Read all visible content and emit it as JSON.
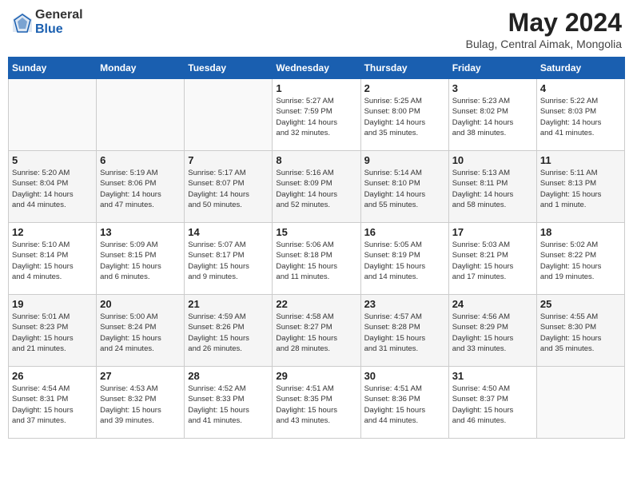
{
  "header": {
    "logo_general": "General",
    "logo_blue": "Blue",
    "month_title": "May 2024",
    "location": "Bulag, Central Aimak, Mongolia"
  },
  "weekdays": [
    "Sunday",
    "Monday",
    "Tuesday",
    "Wednesday",
    "Thursday",
    "Friday",
    "Saturday"
  ],
  "weeks": [
    [
      {
        "day": "",
        "info": ""
      },
      {
        "day": "",
        "info": ""
      },
      {
        "day": "",
        "info": ""
      },
      {
        "day": "1",
        "info": "Sunrise: 5:27 AM\nSunset: 7:59 PM\nDaylight: 14 hours\nand 32 minutes."
      },
      {
        "day": "2",
        "info": "Sunrise: 5:25 AM\nSunset: 8:00 PM\nDaylight: 14 hours\nand 35 minutes."
      },
      {
        "day": "3",
        "info": "Sunrise: 5:23 AM\nSunset: 8:02 PM\nDaylight: 14 hours\nand 38 minutes."
      },
      {
        "day": "4",
        "info": "Sunrise: 5:22 AM\nSunset: 8:03 PM\nDaylight: 14 hours\nand 41 minutes."
      }
    ],
    [
      {
        "day": "5",
        "info": "Sunrise: 5:20 AM\nSunset: 8:04 PM\nDaylight: 14 hours\nand 44 minutes."
      },
      {
        "day": "6",
        "info": "Sunrise: 5:19 AM\nSunset: 8:06 PM\nDaylight: 14 hours\nand 47 minutes."
      },
      {
        "day": "7",
        "info": "Sunrise: 5:17 AM\nSunset: 8:07 PM\nDaylight: 14 hours\nand 50 minutes."
      },
      {
        "day": "8",
        "info": "Sunrise: 5:16 AM\nSunset: 8:09 PM\nDaylight: 14 hours\nand 52 minutes."
      },
      {
        "day": "9",
        "info": "Sunrise: 5:14 AM\nSunset: 8:10 PM\nDaylight: 14 hours\nand 55 minutes."
      },
      {
        "day": "10",
        "info": "Sunrise: 5:13 AM\nSunset: 8:11 PM\nDaylight: 14 hours\nand 58 minutes."
      },
      {
        "day": "11",
        "info": "Sunrise: 5:11 AM\nSunset: 8:13 PM\nDaylight: 15 hours\nand 1 minute."
      }
    ],
    [
      {
        "day": "12",
        "info": "Sunrise: 5:10 AM\nSunset: 8:14 PM\nDaylight: 15 hours\nand 4 minutes."
      },
      {
        "day": "13",
        "info": "Sunrise: 5:09 AM\nSunset: 8:15 PM\nDaylight: 15 hours\nand 6 minutes."
      },
      {
        "day": "14",
        "info": "Sunrise: 5:07 AM\nSunset: 8:17 PM\nDaylight: 15 hours\nand 9 minutes."
      },
      {
        "day": "15",
        "info": "Sunrise: 5:06 AM\nSunset: 8:18 PM\nDaylight: 15 hours\nand 11 minutes."
      },
      {
        "day": "16",
        "info": "Sunrise: 5:05 AM\nSunset: 8:19 PM\nDaylight: 15 hours\nand 14 minutes."
      },
      {
        "day": "17",
        "info": "Sunrise: 5:03 AM\nSunset: 8:21 PM\nDaylight: 15 hours\nand 17 minutes."
      },
      {
        "day": "18",
        "info": "Sunrise: 5:02 AM\nSunset: 8:22 PM\nDaylight: 15 hours\nand 19 minutes."
      }
    ],
    [
      {
        "day": "19",
        "info": "Sunrise: 5:01 AM\nSunset: 8:23 PM\nDaylight: 15 hours\nand 21 minutes."
      },
      {
        "day": "20",
        "info": "Sunrise: 5:00 AM\nSunset: 8:24 PM\nDaylight: 15 hours\nand 24 minutes."
      },
      {
        "day": "21",
        "info": "Sunrise: 4:59 AM\nSunset: 8:26 PM\nDaylight: 15 hours\nand 26 minutes."
      },
      {
        "day": "22",
        "info": "Sunrise: 4:58 AM\nSunset: 8:27 PM\nDaylight: 15 hours\nand 28 minutes."
      },
      {
        "day": "23",
        "info": "Sunrise: 4:57 AM\nSunset: 8:28 PM\nDaylight: 15 hours\nand 31 minutes."
      },
      {
        "day": "24",
        "info": "Sunrise: 4:56 AM\nSunset: 8:29 PM\nDaylight: 15 hours\nand 33 minutes."
      },
      {
        "day": "25",
        "info": "Sunrise: 4:55 AM\nSunset: 8:30 PM\nDaylight: 15 hours\nand 35 minutes."
      }
    ],
    [
      {
        "day": "26",
        "info": "Sunrise: 4:54 AM\nSunset: 8:31 PM\nDaylight: 15 hours\nand 37 minutes."
      },
      {
        "day": "27",
        "info": "Sunrise: 4:53 AM\nSunset: 8:32 PM\nDaylight: 15 hours\nand 39 minutes."
      },
      {
        "day": "28",
        "info": "Sunrise: 4:52 AM\nSunset: 8:33 PM\nDaylight: 15 hours\nand 41 minutes."
      },
      {
        "day": "29",
        "info": "Sunrise: 4:51 AM\nSunset: 8:35 PM\nDaylight: 15 hours\nand 43 minutes."
      },
      {
        "day": "30",
        "info": "Sunrise: 4:51 AM\nSunset: 8:36 PM\nDaylight: 15 hours\nand 44 minutes."
      },
      {
        "day": "31",
        "info": "Sunrise: 4:50 AM\nSunset: 8:37 PM\nDaylight: 15 hours\nand 46 minutes."
      },
      {
        "day": "",
        "info": ""
      }
    ]
  ]
}
